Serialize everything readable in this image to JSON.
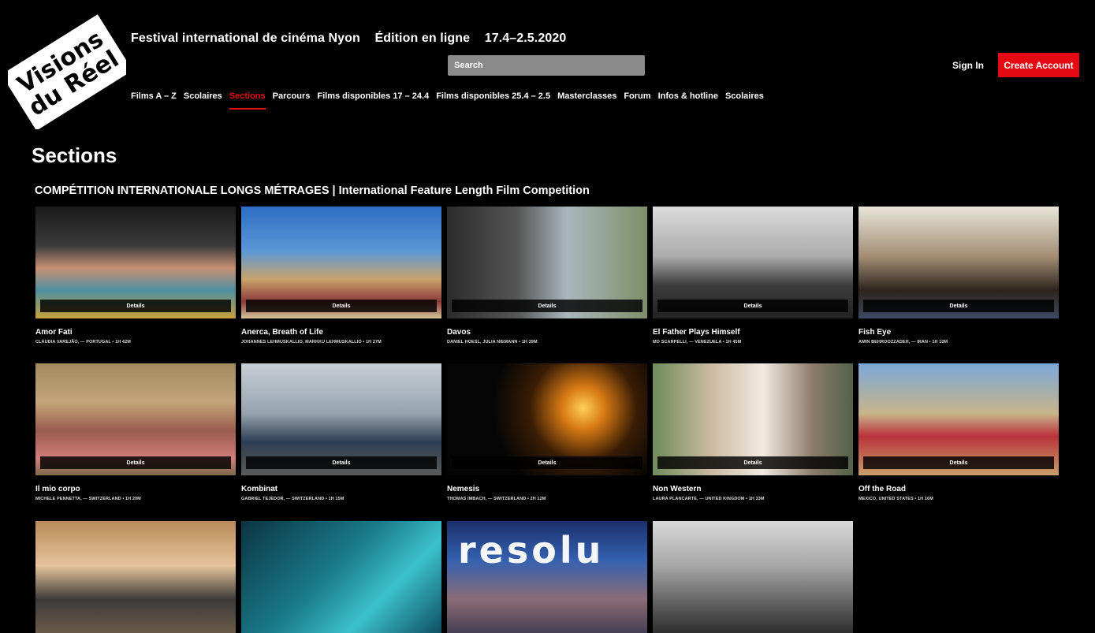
{
  "logo": {
    "line1": "Visions",
    "line2": "du Réel"
  },
  "header": {
    "title": "Festival international de cinéma Nyon",
    "edition": "Édition en ligne",
    "dates": "17.4–2.5.2020"
  },
  "search": {
    "placeholder": "Search"
  },
  "account": {
    "sign_in": "Sign In",
    "create": "Create Account"
  },
  "nav": {
    "items": [
      {
        "label": "Films A – Z",
        "active": false
      },
      {
        "label": "Scolaires",
        "active": false
      },
      {
        "label": "Sections",
        "active": true
      },
      {
        "label": "Parcours",
        "active": false
      },
      {
        "label": "Films disponibles 17 – 24.4",
        "active": false
      },
      {
        "label": "Films disponibles 25.4 – 2.5",
        "active": false
      },
      {
        "label": "Masterclasses",
        "active": false
      },
      {
        "label": "Forum",
        "active": false
      },
      {
        "label": "Infos & hotline",
        "active": false
      },
      {
        "label": "Scolaires",
        "active": false
      }
    ]
  },
  "page": {
    "title": "Sections"
  },
  "section": {
    "title": "COMPÉTITION INTERNATIONALE LONGS MÉTRAGES | International Feature Length Film Competition",
    "details_label": "Details",
    "films": [
      {
        "title": "Amor Fati",
        "meta": "CLÁUDIA VAREJÃO, — PORTUGAL  •  1H 42M"
      },
      {
        "title": "Anerca, Breath of Life",
        "meta": "JOHANNES LEHMUSKALLIO, MARKKU LEHMUSKALLIO  •  1H 27M"
      },
      {
        "title": "Davos",
        "meta": "DANIEL HOESL, JULIA NIEMANN  •  1H 39M"
      },
      {
        "title": "El Father Plays Himself",
        "meta": "MO SCARPELLI, — VENEZUELA  •  1H 45M"
      },
      {
        "title": "Fish Eye",
        "meta": "AMIN BEHROOZZADEH, — IRAN  •  1H 10M"
      },
      {
        "title": "Il mio corpo",
        "meta": "MICHELE PENNETTA, — SWITZERLAND  •  1H 20M"
      },
      {
        "title": "Kombinat",
        "meta": "GABRIEL TEJEDOR, — SWITZERLAND  •  1H 15M"
      },
      {
        "title": "Nemesis",
        "meta": "THOMAS IMBACH, — SWITZERLAND  •  2H 12M"
      },
      {
        "title": "Non Western",
        "meta": "LAURA PLANCARTE, — UNITED KINGDOM  •  1H 33M"
      },
      {
        "title": "Off the Road",
        "meta": "MEXICO, UNITED STATES  •  1H 16M"
      }
    ],
    "partial_overlay_text": "resolu"
  },
  "colors": {
    "accent": "#e50914",
    "background": "#000000"
  }
}
